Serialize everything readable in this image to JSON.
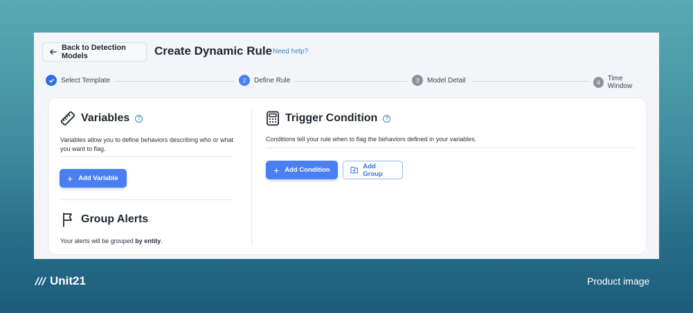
{
  "header": {
    "back_label": "Back to Detection Models",
    "title": "Create Dynamic Rule",
    "help_link": "Need help?"
  },
  "stepper": {
    "steps": [
      {
        "label": "Select Template",
        "number": "1",
        "state": "done"
      },
      {
        "label": "Define Rule",
        "number": "2",
        "state": "active"
      },
      {
        "label": "Model Detail",
        "number": "3",
        "state": "pending"
      },
      {
        "label": "Time Window",
        "number": "4",
        "state": "pending"
      }
    ]
  },
  "variables": {
    "title": "Variables",
    "description": "Variables allow you to define behaviors describing who or what you want to flag.",
    "add_label": "Add Variable"
  },
  "group_alerts": {
    "title": "Group Alerts",
    "description_prefix": "Your alerts will be grouped ",
    "description_bold": "by entity",
    "description_suffix": "."
  },
  "trigger": {
    "title": "Trigger Condition",
    "description": "Conditions tell your rule when to flag the behaviors defined in your variables.",
    "add_condition_label": "Add Condition",
    "add_group_label": "Add Group"
  },
  "footer": {
    "brand": "Unit21",
    "caption": "Product image"
  },
  "colors": {
    "primary": "#4a7ff0",
    "step_done": "#2f6fe4",
    "step_pending": "#8e939c",
    "help_icon": "#2f8aa6"
  }
}
